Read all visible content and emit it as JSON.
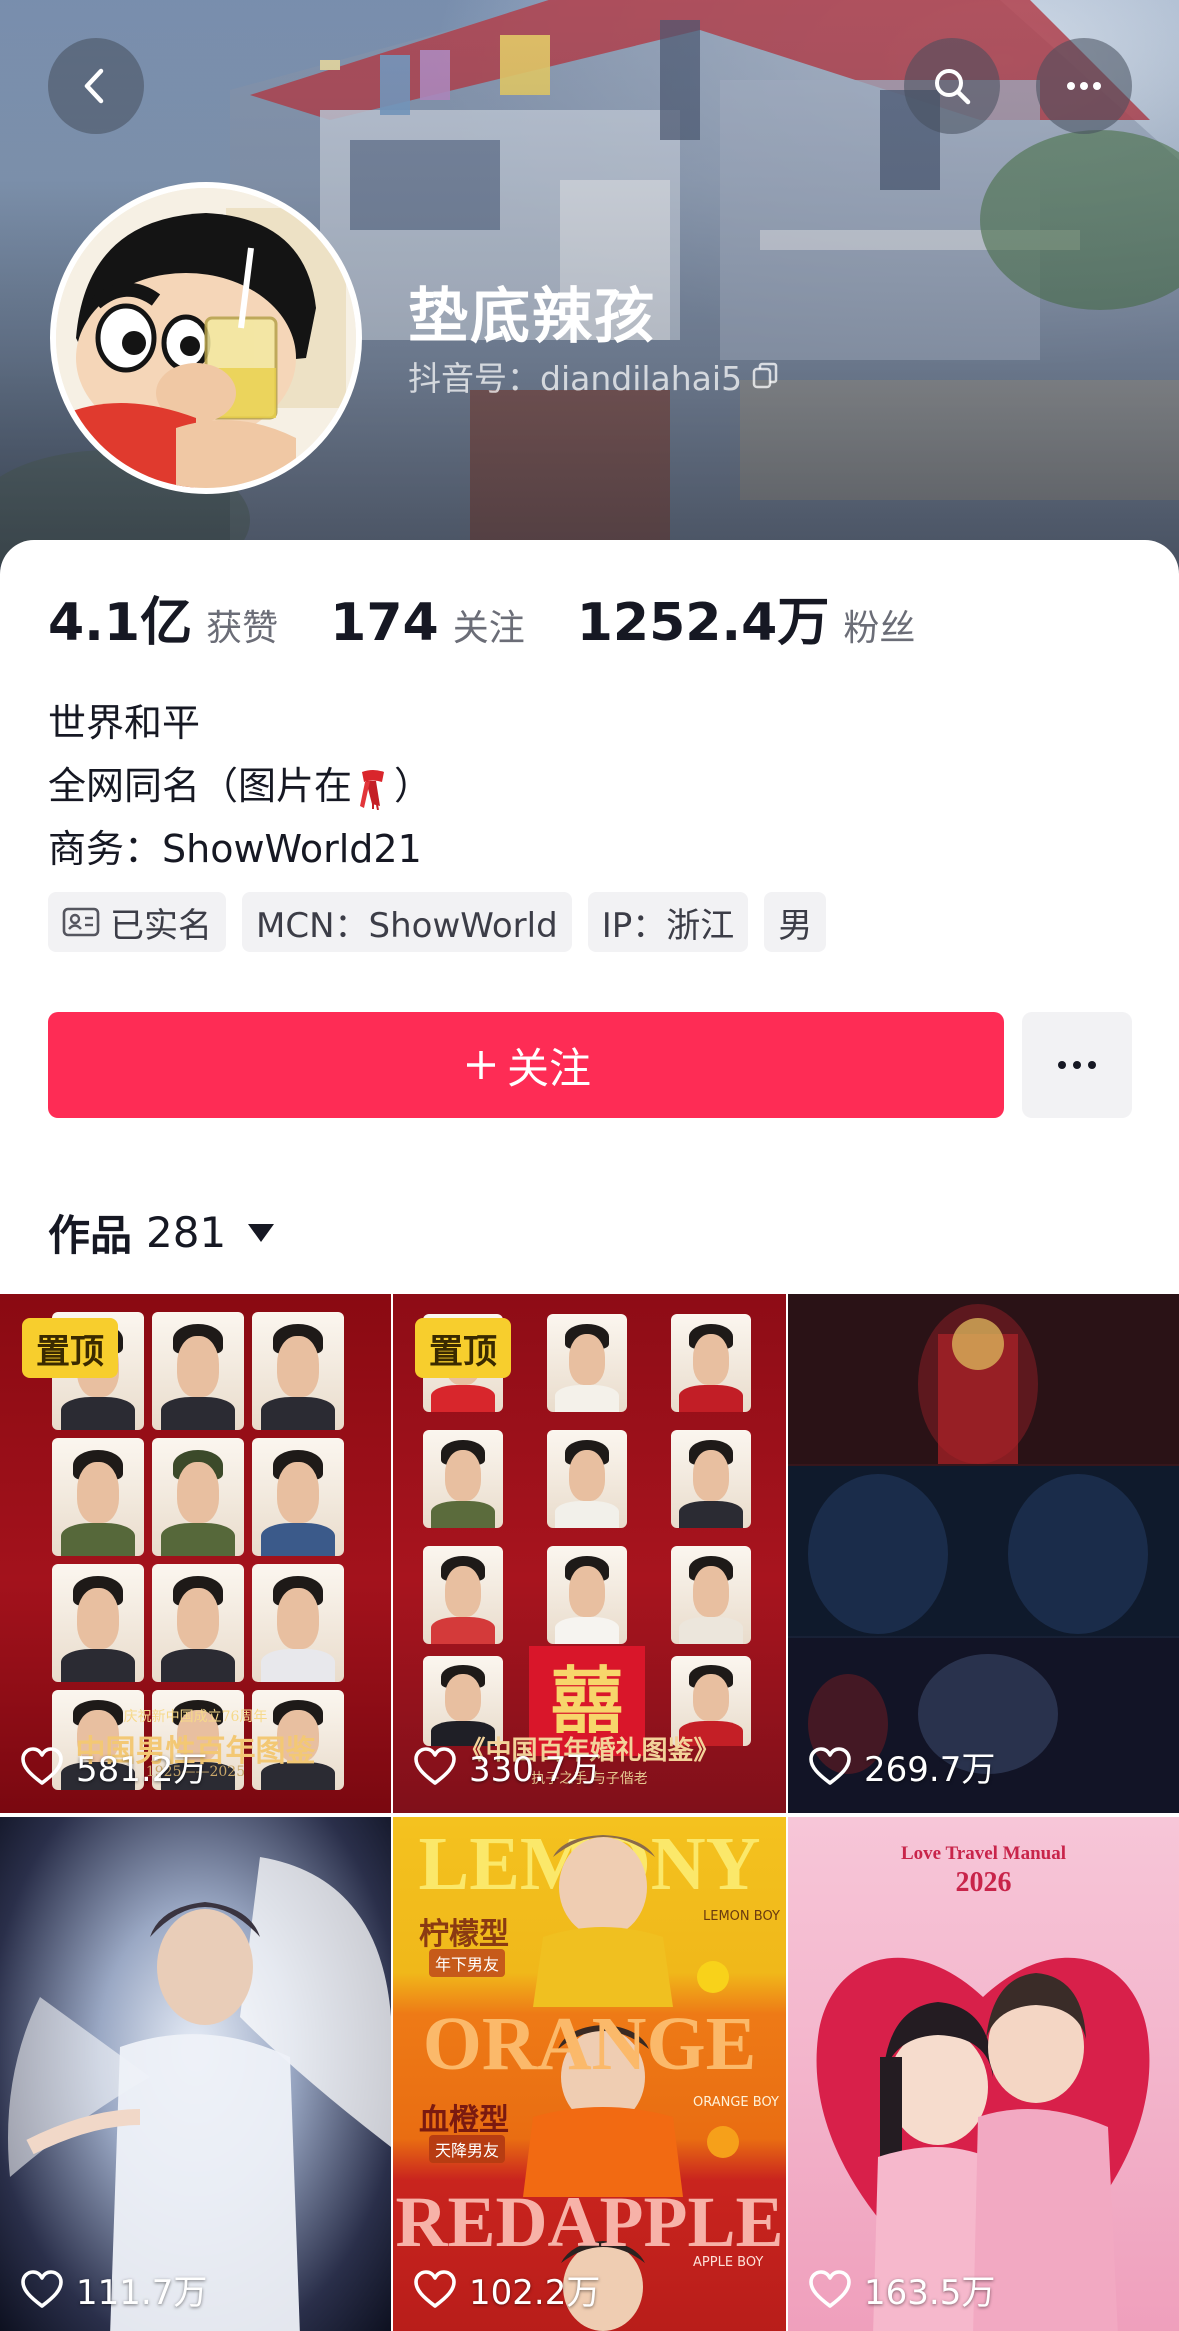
{
  "profile": {
    "nickname": "垫底辣孩",
    "douyin_id": "抖音号：diandilahai5"
  },
  "stats": [
    {
      "value": "4.1亿",
      "label": "获赞"
    },
    {
      "value": "174",
      "label": "关注"
    },
    {
      "value": "1252.4万",
      "label": "粉丝"
    }
  ],
  "bio": {
    "line1": "世界和平",
    "line2_prefix": "全网同名（图片在",
    "line2_suffix": "）",
    "line3": "商务：ShowWorld21"
  },
  "tags": {
    "verified": "已实名",
    "mcn": "MCN：ShowWorld",
    "ip": "IP：浙江",
    "gender": "男"
  },
  "actions": {
    "follow_label": "关注"
  },
  "works": {
    "label": "作品",
    "count": "281"
  },
  "videos": [
    {
      "pinned": "置顶",
      "likes": "581.2万",
      "caption": "庆祝新中国成立76周年",
      "caption2": "中国男性百年图鉴",
      "caption3": "1925——2025"
    },
    {
      "pinned": "置顶",
      "likes": "330.7万",
      "caption": "《中国百年婚礼图鉴》",
      "caption2": "执子之手 与子偕老"
    },
    {
      "likes": "269.7万"
    },
    {
      "likes": "111.7万"
    },
    {
      "likes": "102.2万",
      "word1": "LEMONY",
      "tag1": "柠檬型",
      "sub1": "年下男友",
      "eng1": "LEMON BOY",
      "word2": "ORANGE",
      "tag2": "血橙型",
      "sub2": "天降男友",
      "eng2": "ORANGE BOY",
      "word3": "REDAPPLE",
      "eng3": "APPLE BOY"
    },
    {
      "likes": "163.5万",
      "title": "Love Travel Manual",
      "year": "2026"
    }
  ],
  "colors": {
    "accent": "#fe2c55",
    "pin": "#f7ce2d"
  }
}
